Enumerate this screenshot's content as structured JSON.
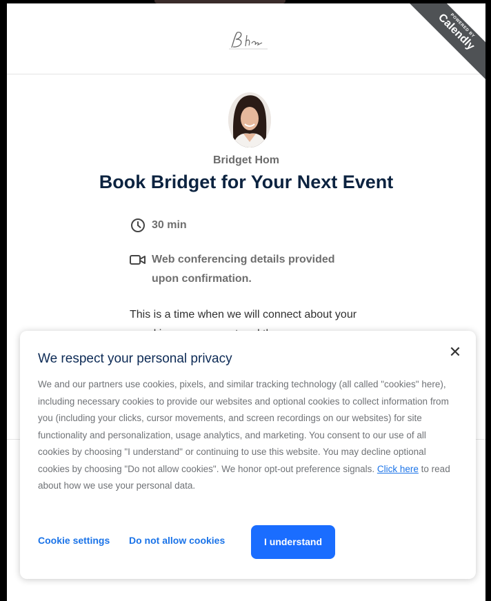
{
  "branding": {
    "logo_icon": "bh-signature-logo",
    "ribbon_powered_by": "POWERED BY",
    "ribbon_brand": "Calendly"
  },
  "profile": {
    "avatar_icon": "host-avatar",
    "host_name": "Bridget Hom",
    "event_title": "Book Bridget for Your Next Event"
  },
  "details": {
    "duration": "30 min",
    "duration_icon": "clock-icon",
    "conferencing": "Web conferencing details provided upon confirmation.",
    "conferencing_icon": "video-camera-icon"
  },
  "description": "This is a time when we will connect about your speaking engagement and the",
  "cookie_banner": {
    "title": "We respect your personal privacy",
    "close_icon": "close-icon",
    "body_text": "We and our partners use cookies, pixels, and similar tracking technology (all called \"cookies\" here), including necessary cookies to provide our websites and optional cookies to collect information from you (including your clicks, cursor movements, and screen recordings on our websites) for site functionality and personalization, usage analytics, and marketing. You consent to our use of all cookies by choosing \"I understand\" or continuing to use this website. You may decline optional cookies by choosing \"Do not allow cookies\". We honor opt-out preference signals.",
    "link_text": "Click here",
    "body_tail": "to read about how we use your personal data.",
    "settings_label": "Cookie settings",
    "decline_label": "Do not allow cookies",
    "accept_label": "I understand"
  },
  "colors": {
    "primary_blue": "#1a6dff",
    "title_navy": "#0c2340"
  }
}
